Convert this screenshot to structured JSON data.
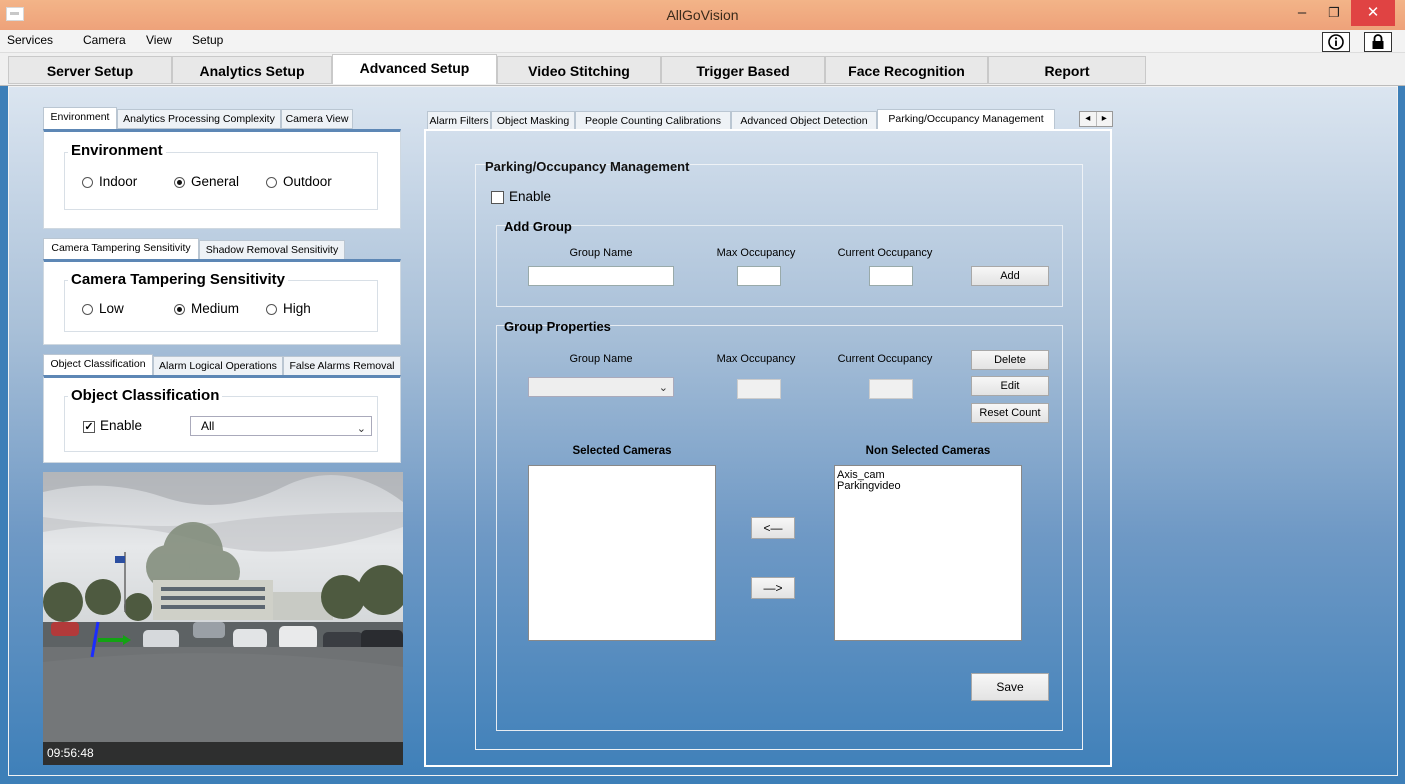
{
  "window": {
    "title": "AllGoVision",
    "minimize_glyph": "–",
    "restore_glyph": "❐",
    "close_glyph": "✕"
  },
  "menu": {
    "items": [
      "Services",
      "Camera",
      "View",
      "Setup"
    ],
    "info_icon": "info-icon",
    "lock_icon": "lock-icon"
  },
  "main_tabs": [
    "Server Setup",
    "Analytics Setup",
    "Advanced Setup",
    "Video Stitching",
    "Trigger Based",
    "Face Recognition",
    "Report"
  ],
  "main_tabs_active": "Advanced Setup",
  "env_panel": {
    "tabs": [
      "Environment",
      "Analytics Processing Complexity",
      "Camera View"
    ],
    "group_title": "Environment",
    "options": [
      "Indoor",
      "General",
      "Outdoor"
    ],
    "selected": "General"
  },
  "tamper_panel": {
    "tabs": [
      "Camera Tampering Sensitivity",
      "Shadow Removal Sensitivity"
    ],
    "group_title": "Camera Tampering Sensitivity",
    "options": [
      "Low",
      "Medium",
      "High"
    ],
    "selected": "Medium"
  },
  "objclass_panel": {
    "tabs": [
      "Object Classification",
      "Alarm Logical Operations",
      "False Alarms Removal"
    ],
    "group_title": "Object Classification",
    "enable_label": "Enable",
    "enable_checked": true,
    "select_value": "All"
  },
  "camera": {
    "timestamp": "09:56:48"
  },
  "right_panel": {
    "tabs": [
      "Alarm Filters",
      "Object Masking",
      "People Counting Calibrations",
      "Advanced Object Detection",
      "Parking/Occupancy Management"
    ],
    "active_tab": "Parking/Occupancy Management",
    "scroll_left": "◂",
    "scroll_right": "▸",
    "title": "Parking/Occupancy Management",
    "enable_label": "Enable",
    "enable_checked": false,
    "add_group": {
      "title": "Add Group",
      "group_name_label": "Group Name",
      "max_label": "Max Occupancy",
      "current_label": "Current Occupancy",
      "add_button": "Add"
    },
    "group_props": {
      "title": "Group Properties",
      "group_name_label": "Group Name",
      "max_label": "Max Occupancy",
      "current_label": "Current Occupancy",
      "delete_button": "Delete",
      "edit_button": "Edit",
      "reset_button": "Reset Count",
      "selected_label": "Selected Cameras",
      "non_selected_label": "Non Selected Cameras",
      "non_selected_items": [
        "Axis_cam",
        "Parkingvideo"
      ],
      "move_left": "<—",
      "move_right": "—>",
      "save_button": "Save"
    }
  }
}
